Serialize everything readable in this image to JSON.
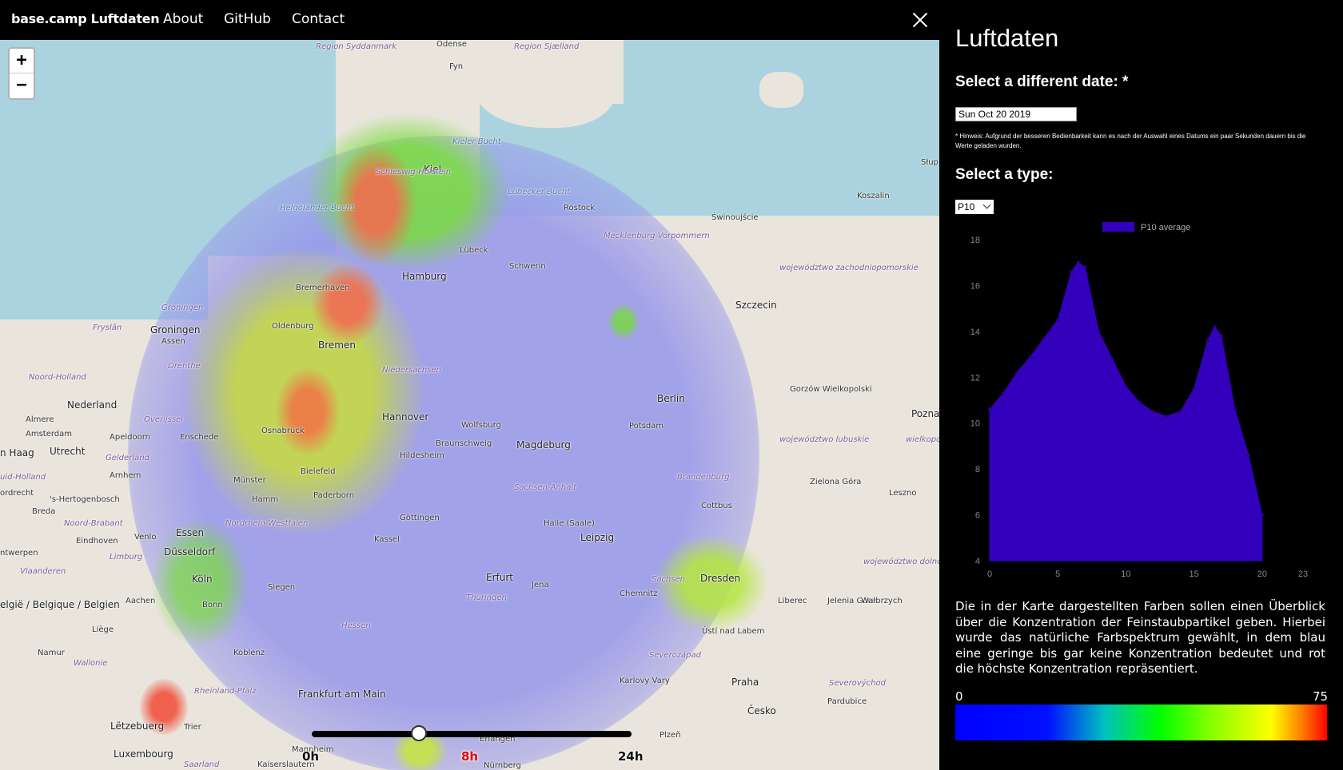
{
  "nav": {
    "brand": "base.camp Luftdaten",
    "links": [
      "About",
      "GitHub",
      "Contact"
    ]
  },
  "map": {
    "zoom_in": "+",
    "zoom_out": "−",
    "labels": {
      "odense": "Odense",
      "fyn": "Fyn",
      "syddanmark": "Region Syddanmark",
      "sjaelland": "Region Sjælland",
      "kieler_bucht": "Kieler Bucht",
      "kiel": "Kiel",
      "schleswig": "Schleswig-Holstein",
      "luebecker_bucht": "Lübecker Bucht",
      "helgolander": "Helgoländer Bucht",
      "rostock": "Rostock",
      "swinoujscie": "Świnoujście",
      "koszalin": "Koszalin",
      "mecklenburg": "Mecklenburg-Vorpommern",
      "luebeck": "Lübeck",
      "hamburg": "Hamburg",
      "schwerin": "Schwerin",
      "bremerhaven": "Bremerhaven",
      "zachodnio": "województwo zachodniopomorskie",
      "szczecin": "Szczecin",
      "groningen_r": "Groningen",
      "groningen": "Groningen",
      "fryslan": "Fryslân",
      "assen": "Assen",
      "oldenburg": "Oldenburg",
      "bremen": "Bremen",
      "drenthe": "Drenthe",
      "noord_holland": "Noord-Holland",
      "niedersachsen": "Niedersachsen",
      "gorzow": "Gorzów Wielkopolski",
      "nederland": "Nederland",
      "overijssel": "Overijssel",
      "berlin": "Berlin",
      "hannover": "Hannover",
      "wolfsburg": "Wolfsburg",
      "potsdam": "Potsdam",
      "poznan": "Poznań",
      "almere": "Almere",
      "amsterdam": "Amsterdam",
      "apeldoorn": "Apeldoorn",
      "enschede": "Enschede",
      "osnabrueck": "Osnabrück",
      "braunschweig": "Braunschweig",
      "magdeburg": "Magdeburg",
      "lubuskie": "województwo lubuskie",
      "wielkopolskie": "wielkopo",
      "den_haag": "n Haag",
      "utrecht": "Utrecht",
      "gelderland": "Gelderland",
      "hildesheim": "Hildesheim",
      "zuid_holland": "uid-Holland",
      "arnhem": "Arnhem",
      "bielefeld": "Bielefeld",
      "brandenburg": "Brandenburg",
      "rotterdam": "ordrecht",
      "hertogenbosch": "'s-Hertogenbosch",
      "muenster": "Münster",
      "paderborn": "Paderborn",
      "sachsen_anhalt": "Sachsen-Anhalt",
      "zielona": "Zielona Góra",
      "leszno": "Leszno",
      "breda": "Breda",
      "hamm": "Hamm",
      "goettingen": "Göttingen",
      "cottbus": "Cottbus",
      "noord_brabant": "Noord-Brabant",
      "nrw": "Nordrhein-Westfalen",
      "venlo": "Venlo",
      "essen": "Essen",
      "halle": "Halle (Saale)",
      "eindhoven": "Eindhoven",
      "kassel": "Kassel",
      "leipzig": "Leipzig",
      "antwerpen": "ntwerpen",
      "duesseldorf": "Düsseldorf",
      "limburg": "Limburg",
      "dolnoslaskie": "województwo dolnośląskie",
      "vlaanderen": "Vlaanderen",
      "koeln": "Köln",
      "erfurt": "Erfurt",
      "sachsen": "Sachsen",
      "dresden": "Dresden",
      "jena": "Jena",
      "siegen": "Siegen",
      "chemnitz": "Chemnitz",
      "belgique": "elgië / Belgique / Belgien",
      "aachen": "Aachen",
      "bonn": "Bonn",
      "thueringen": "Thüringen",
      "liberec": "Liberec",
      "jelenia": "Jelenia Góra",
      "walbrzych": "Wałbrzych",
      "liege": "Liège",
      "hessen": "Hessen",
      "usti": "Ústí nad Labem",
      "namur": "Namur",
      "koblenz": "Koblenz",
      "wallonie": "Wallonie",
      "severozapad": "Severozápad",
      "praha": "Praha",
      "karlovy": "Karlovy Vary",
      "severovychod": "Severovýchod",
      "rlp": "Rheinland-Pfalz",
      "frankfurt": "Frankfurt am Main",
      "pardubice": "Pardubice",
      "cesko": "Česko",
      "letzebuerg": "Lëtzebuerg",
      "trier": "Trier",
      "plzen": "Plzeň",
      "luxembourg": "Luxembourg",
      "mannheim": "Mannheim",
      "erlangen": "Erlangen",
      "nuernberg": "Nürnberg",
      "saarland": "Saarland",
      "kaiserslautern": "Kaiserslautern",
      "slupsk": "Słup"
    }
  },
  "slider": {
    "start": "0h",
    "current": "8h",
    "end": "24h",
    "current_color": "#e8000b",
    "position_fraction": 0.333
  },
  "sidebar": {
    "title": "Luftdaten",
    "date_heading": "Select a different date: *",
    "date_value": "Sun Oct 20 2019",
    "hint": "* Hinweis: Aufgrund der besseren Bedienbarkeit kann es nach der Auswahl eines Datums ein paar Sekunden dauern bis die Werte geladen wurden.",
    "type_heading": "Select a type:",
    "type_value": "P10",
    "description": "Die in der Karte dargestellten Farben sollen einen Überblick über die Konzentration der Feinstaubpartikel geben. Hierbei wurde das natürliche Farbspektrum gewählt, in dem blau eine geringe bis gar keine Konzentration bedeutet und rot die höchste Konzentration repräsentiert.",
    "scale_min": "0",
    "scale_max": "75"
  },
  "colors": {
    "series": "#3300bb",
    "accent_red": "#e8000b"
  },
  "chart_data": {
    "type": "area",
    "legend": [
      "P10 average"
    ],
    "series": [
      {
        "name": "P10 average",
        "x": [
          0,
          1,
          2,
          3,
          4,
          5,
          6,
          6.5,
          7,
          8,
          9,
          10,
          11,
          12,
          13,
          14,
          15,
          16,
          16.5,
          17,
          18,
          19,
          20
        ],
        "values": [
          10.6,
          11.3,
          12.2,
          12.9,
          13.7,
          14.5,
          16.6,
          17.0,
          16.8,
          14.0,
          12.8,
          11.6,
          10.9,
          10.5,
          10.3,
          10.5,
          11.5,
          13.6,
          14.2,
          13.8,
          10.6,
          8.6,
          6.0
        ]
      }
    ],
    "xlim": [
      0,
      23
    ],
    "ylim": [
      4,
      18
    ],
    "xticks": [
      0,
      5,
      10,
      15,
      20,
      23
    ],
    "yticks": [
      4,
      6,
      8,
      10,
      12,
      14,
      16,
      18
    ],
    "legend_position": "top-center"
  }
}
